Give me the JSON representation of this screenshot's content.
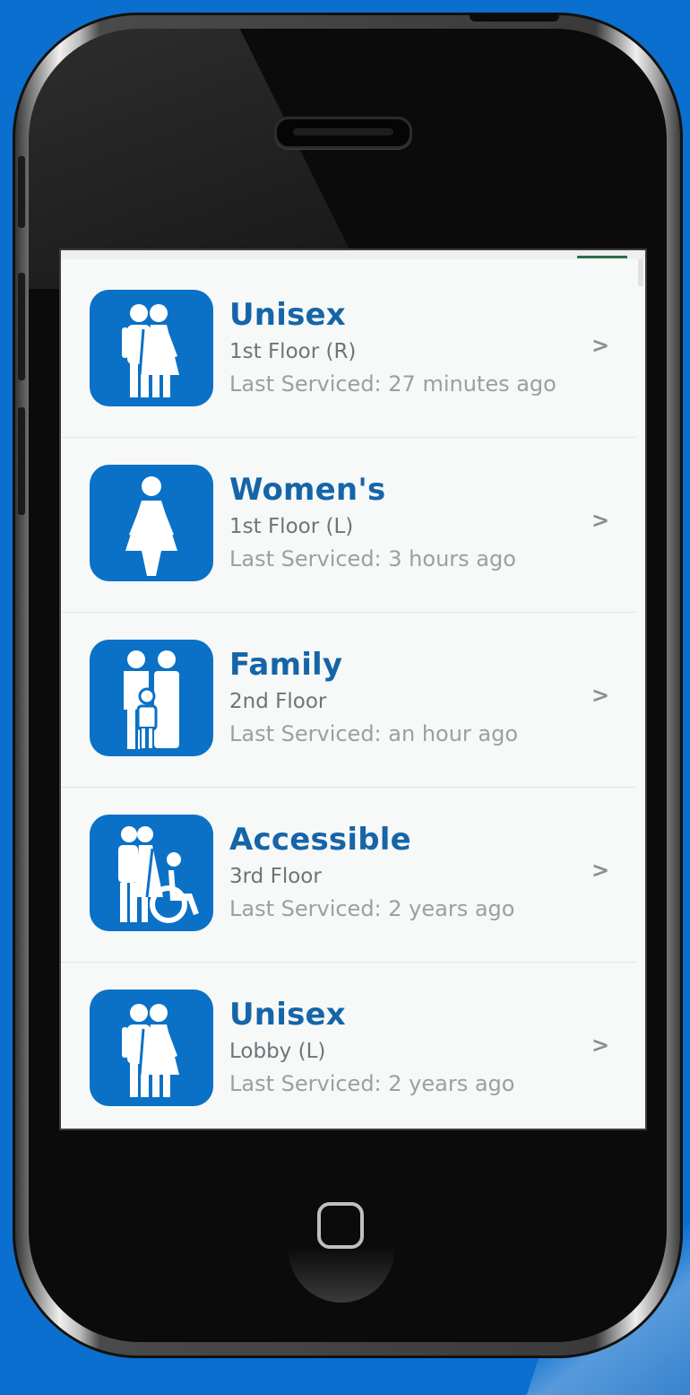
{
  "restrooms": [
    {
      "name": "Unisex",
      "location": "1st Floor (R)",
      "last_serviced": "Last Serviced: 27 minutes ago",
      "icon": "unisex-restroom-icon"
    },
    {
      "name": "Women's",
      "location": "1st Floor (L)",
      "last_serviced": "Last Serviced: 3 hours ago",
      "icon": "womens-restroom-icon"
    },
    {
      "name": "Family",
      "location": "2nd Floor",
      "last_serviced": "Last Serviced: an hour ago",
      "icon": "family-restroom-icon"
    },
    {
      "name": "Accessible",
      "location": "3rd Floor",
      "last_serviced": "Last Serviced: 2 years ago",
      "icon": "accessible-restroom-icon"
    },
    {
      "name": "Unisex",
      "location": "Lobby (L)",
      "last_serviced": "Last Serviced: 2 years ago",
      "icon": "unisex-restroom-icon"
    }
  ],
  "chevron": ">",
  "colors": {
    "background": "#0a6fcf",
    "tile": "#0a71c6",
    "title": "#1565a8",
    "subtitle": "#6f7478",
    "serviced": "#9aa0a3"
  }
}
